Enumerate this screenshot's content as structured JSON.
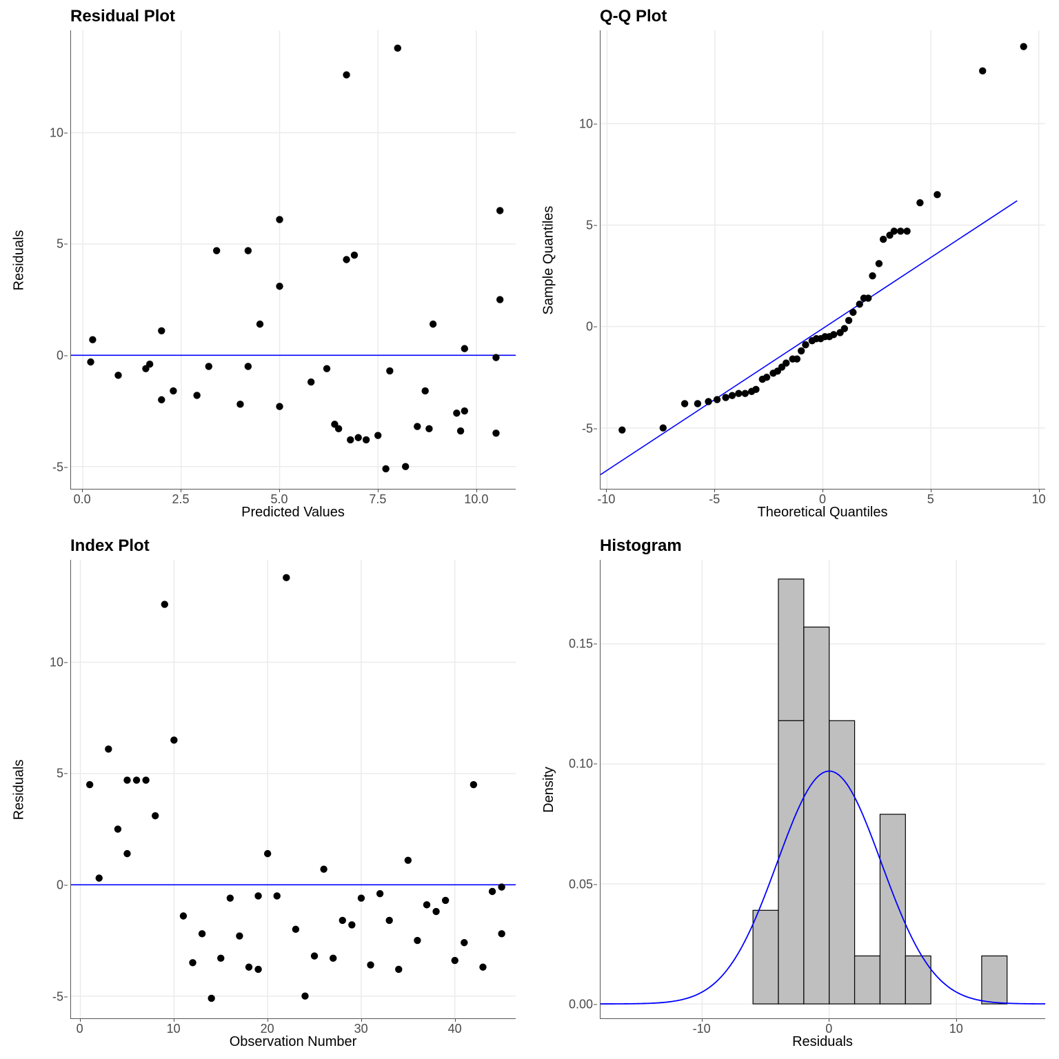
{
  "chart_data": [
    {
      "id": "residual",
      "type": "scatter",
      "title": "Residual Plot",
      "xlabel": "Predicted Values",
      "ylabel": "Residuals",
      "xlim": [
        -0.3,
        11.0
      ],
      "ylim": [
        -6.0,
        14.6
      ],
      "xticks": [
        0.0,
        2.5,
        5.0,
        7.5,
        10.0
      ],
      "yticks": [
        -5,
        0,
        5,
        10
      ],
      "hline": 0,
      "points_xy": [
        [
          0.2,
          -0.3
        ],
        [
          0.25,
          0.7
        ],
        [
          0.9,
          -0.9
        ],
        [
          1.6,
          -0.6
        ],
        [
          1.7,
          -0.4
        ],
        [
          2.0,
          1.1
        ],
        [
          2.0,
          -2.0
        ],
        [
          2.3,
          -1.6
        ],
        [
          2.9,
          -1.8
        ],
        [
          3.2,
          -0.5
        ],
        [
          3.4,
          4.7
        ],
        [
          4.0,
          -2.2
        ],
        [
          4.2,
          4.7
        ],
        [
          4.2,
          -0.5
        ],
        [
          4.5,
          1.4
        ],
        [
          5.0,
          3.1
        ],
        [
          5.0,
          6.1
        ],
        [
          5.0,
          -2.3
        ],
        [
          5.8,
          -1.2
        ],
        [
          6.2,
          -0.6
        ],
        [
          6.4,
          -3.1
        ],
        [
          6.5,
          -3.3
        ],
        [
          6.8,
          -3.8
        ],
        [
          6.7,
          4.3
        ],
        [
          6.7,
          12.6
        ],
        [
          6.9,
          4.5
        ],
        [
          7.0,
          -3.7
        ],
        [
          7.2,
          -3.8
        ],
        [
          7.5,
          -3.6
        ],
        [
          7.7,
          -5.1
        ],
        [
          7.8,
          -0.7
        ],
        [
          8.0,
          13.8
        ],
        [
          8.2,
          -5.0
        ],
        [
          8.5,
          -3.2
        ],
        [
          8.7,
          -1.6
        ],
        [
          8.8,
          -3.3
        ],
        [
          8.9,
          1.4
        ],
        [
          9.5,
          -2.6
        ],
        [
          9.6,
          -3.4
        ],
        [
          9.7,
          -2.5
        ],
        [
          9.7,
          0.3
        ],
        [
          10.5,
          -3.5
        ],
        [
          10.6,
          2.5
        ],
        [
          10.6,
          6.5
        ],
        [
          10.5,
          -0.1
        ]
      ]
    },
    {
      "id": "qq",
      "type": "scatter",
      "title": "Q-Q Plot",
      "xlabel": "Theoretical Quantiles",
      "ylabel": "Sample Quantiles",
      "xlim": [
        -10.3,
        10.3
      ],
      "ylim": [
        -8.0,
        14.6
      ],
      "xticks": [
        -10,
        -5,
        0,
        5,
        10
      ],
      "yticks": [
        -5,
        0,
        5,
        10
      ],
      "abline": {
        "from": [
          -10.3,
          -7.3
        ],
        "to": [
          9.0,
          6.2
        ]
      },
      "points_xy": [
        [
          -9.3,
          -5.1
        ],
        [
          -7.4,
          -5.0
        ],
        [
          -6.4,
          -3.8
        ],
        [
          -5.8,
          -3.8
        ],
        [
          -5.3,
          -3.7
        ],
        [
          -4.9,
          -3.6
        ],
        [
          -4.5,
          -3.5
        ],
        [
          -4.2,
          -3.4
        ],
        [
          -3.9,
          -3.3
        ],
        [
          -3.6,
          -3.3
        ],
        [
          -3.3,
          -3.2
        ],
        [
          -3.1,
          -3.1
        ],
        [
          -2.8,
          -2.6
        ],
        [
          -2.6,
          -2.5
        ],
        [
          -2.3,
          -2.3
        ],
        [
          -2.1,
          -2.2
        ],
        [
          -1.9,
          -2.0
        ],
        [
          -1.7,
          -1.8
        ],
        [
          -1.4,
          -1.6
        ],
        [
          -1.2,
          -1.6
        ],
        [
          -1.0,
          -1.2
        ],
        [
          -0.8,
          -0.9
        ],
        [
          -0.5,
          -0.7
        ],
        [
          -0.3,
          -0.6
        ],
        [
          -0.1,
          -0.6
        ],
        [
          0.1,
          -0.5
        ],
        [
          0.3,
          -0.5
        ],
        [
          0.5,
          -0.4
        ],
        [
          0.8,
          -0.3
        ],
        [
          1.0,
          -0.1
        ],
        [
          1.2,
          0.3
        ],
        [
          1.4,
          0.7
        ],
        [
          1.7,
          1.1
        ],
        [
          1.9,
          1.4
        ],
        [
          2.1,
          1.4
        ],
        [
          2.3,
          2.5
        ],
        [
          2.6,
          3.1
        ],
        [
          2.8,
          4.3
        ],
        [
          3.1,
          4.5
        ],
        [
          3.3,
          4.7
        ],
        [
          3.6,
          4.7
        ],
        [
          3.9,
          4.7
        ],
        [
          4.5,
          6.1
        ],
        [
          5.3,
          6.5
        ],
        [
          7.4,
          12.6
        ],
        [
          9.3,
          13.8
        ]
      ]
    },
    {
      "id": "index",
      "type": "scatter",
      "title": "Index Plot",
      "xlabel": "Observation Number",
      "ylabel": "Residuals",
      "xlim": [
        -1.0,
        46.5
      ],
      "ylim": [
        -6.0,
        14.6
      ],
      "xticks": [
        0,
        10,
        20,
        30,
        40
      ],
      "yticks": [
        -5,
        0,
        5,
        10
      ],
      "hline": 0,
      "points_xy": [
        [
          1,
          4.5
        ],
        [
          2,
          0.3
        ],
        [
          3,
          6.1
        ],
        [
          4,
          2.5
        ],
        [
          5,
          4.7
        ],
        [
          5,
          1.4
        ],
        [
          6,
          4.7
        ],
        [
          7,
          4.7
        ],
        [
          8,
          3.1
        ],
        [
          9,
          12.6
        ],
        [
          10,
          6.5
        ],
        [
          11,
          -1.4
        ],
        [
          12,
          -3.5
        ],
        [
          13,
          -2.2
        ],
        [
          14,
          -5.1
        ],
        [
          15,
          -3.3
        ],
        [
          16,
          -0.6
        ],
        [
          17,
          -2.3
        ],
        [
          18,
          -3.7
        ],
        [
          19,
          -3.8
        ],
        [
          19,
          -0.5
        ],
        [
          20,
          1.4
        ],
        [
          21,
          -0.5
        ],
        [
          22,
          13.8
        ],
        [
          23,
          -2.0
        ],
        [
          24,
          -5.0
        ],
        [
          25,
          -3.2
        ],
        [
          26,
          0.7
        ],
        [
          27,
          -3.3
        ],
        [
          28,
          -1.6
        ],
        [
          29,
          -1.8
        ],
        [
          30,
          -0.6
        ],
        [
          31,
          -3.6
        ],
        [
          32,
          -0.4
        ],
        [
          33,
          -1.6
        ],
        [
          34,
          -3.8
        ],
        [
          35,
          1.1
        ],
        [
          36,
          -2.5
        ],
        [
          37,
          -0.9
        ],
        [
          38,
          -1.2
        ],
        [
          39,
          -0.7
        ],
        [
          40,
          -3.4
        ],
        [
          41,
          -2.6
        ],
        [
          42,
          4.5
        ],
        [
          43,
          -3.7
        ],
        [
          44,
          -0.3
        ],
        [
          45,
          -2.2
        ],
        [
          45,
          -0.1
        ]
      ]
    },
    {
      "id": "hist",
      "type": "bar",
      "title": "Histogram",
      "xlabel": "Residuals",
      "ylabel": "Density",
      "xlim": [
        -18,
        17
      ],
      "ylim": [
        -0.006,
        0.185
      ],
      "xticks": [
        -10,
        0,
        10
      ],
      "yticks": [
        0.0,
        0.05,
        0.1,
        0.15
      ],
      "bin_width": 2,
      "bars": [
        {
          "x0": -6,
          "x1": -4,
          "y": 0.039
        },
        {
          "x0": -4,
          "x1": -2,
          "y": 0.177
        },
        {
          "x0": -2,
          "x1": 0,
          "y": 0.157
        },
        {
          "x0": 0,
          "x1": 2,
          "y": 0.118
        },
        {
          "x0": 2,
          "x1": 4,
          "y": 0.02
        },
        {
          "x0": 4,
          "x1": 6,
          "y": 0.079
        },
        {
          "x0": 6,
          "x1": 8,
          "y": 0.02
        },
        {
          "x0": 12,
          "x1": 14,
          "y": 0.02
        },
        {
          "x0": -4,
          "x1": -2,
          "y2_center": 0.118
        }
      ],
      "curve": "normal",
      "curve_params": {
        "mu": 0.0,
        "sigma": 4.1,
        "scale": 0.097
      }
    }
  ]
}
